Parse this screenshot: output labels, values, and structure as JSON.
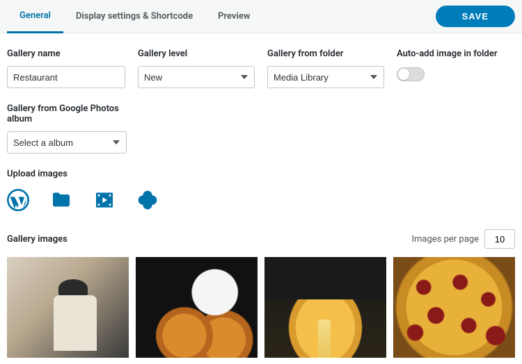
{
  "tabs": {
    "general": "General",
    "display": "Display settings & Shortcode",
    "preview": "Preview"
  },
  "buttons": {
    "save": "SAVE"
  },
  "fields": {
    "gallery_name": {
      "label": "Gallery name",
      "value": "Restaurant"
    },
    "gallery_level": {
      "label": "Gallery level",
      "value": "New"
    },
    "gallery_from_folder": {
      "label": "Gallery from folder",
      "value": "Media Library"
    },
    "auto_add": {
      "label": "Auto-add image in folder",
      "value": false
    },
    "google_photos": {
      "label": "Gallery from Google Photos album",
      "value": "Select a album"
    }
  },
  "sections": {
    "upload": "Upload images",
    "gallery": "Gallery images"
  },
  "pagination": {
    "label": "Images per page",
    "value": "10"
  },
  "icons": {
    "wordpress": "wordpress-icon",
    "folder": "folder-icon",
    "video": "video-icon",
    "google_photos": "google-photos-icon"
  }
}
